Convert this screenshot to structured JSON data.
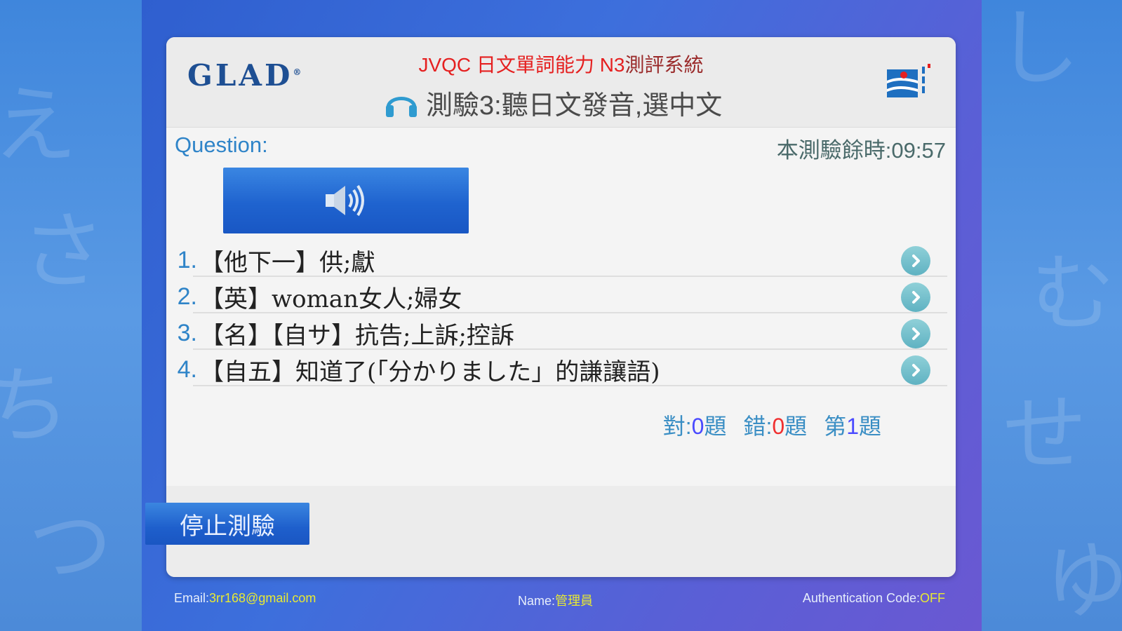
{
  "header": {
    "logo": "GLAD",
    "logo_mark": "®",
    "system_title_prefix": "JVQC 日文單詞能力 N3",
    "system_title_suffix": "測評系統",
    "test_title": "測驗3:聽日文發音,選中文"
  },
  "question": {
    "label": "Question:",
    "timer": "本測驗餘時:09:57"
  },
  "options": [
    {
      "num": "1.",
      "text": "【他下一】供;獻"
    },
    {
      "num": "2.",
      "text": "【英】woman女人;婦女"
    },
    {
      "num": "3.",
      "text": "【名】【自サ】抗告;上訴;控訴"
    },
    {
      "num": "4.",
      "text": "【自五】知道了(「分かりました」的謙讓語)"
    }
  ],
  "score": {
    "correct_label": "對:",
    "correct_value": "0",
    "correct_unit": "題",
    "wrong_label": "錯:",
    "wrong_value": "0",
    "wrong_unit": "題",
    "index_label": "第",
    "index_value": "1",
    "index_unit": "題"
  },
  "actions": {
    "stop_label": "停止測驗"
  },
  "footer": {
    "email_label": "Email:",
    "email_value": "3rr168@gmail.com",
    "name_label": "Name:",
    "name_value": "管理員",
    "auth_label": "Authentication Code:",
    "auth_value": "OFF"
  },
  "colors": {
    "accent_blue": "#1f63cf",
    "title_red": "#e52020",
    "label_blue": "#2f84c8",
    "footer_value": "#e8ea32"
  },
  "icons": [
    "headphone-icon",
    "brand-logo-icon",
    "speaker-icon",
    "chevron-right-icon"
  ]
}
